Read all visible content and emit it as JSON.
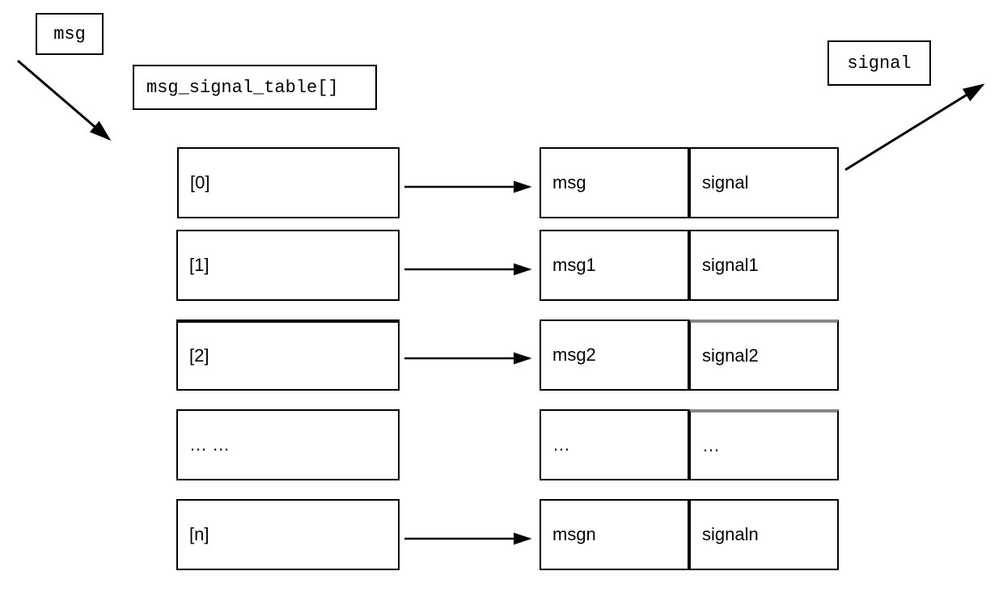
{
  "input_label": "msg",
  "output_label": "signal",
  "table_name": "msg_signal_table[]",
  "index_column": [
    "[0]",
    "[1]",
    "[2]",
    "… …",
    "[n]"
  ],
  "mapping": [
    {
      "msg": "msg",
      "signal": "signal"
    },
    {
      "msg": "msg1",
      "signal": "signal1"
    },
    {
      "msg": "msg2",
      "signal": "signal2"
    },
    {
      "msg": "…",
      "signal": "…"
    },
    {
      "msg": "msgn",
      "signal": "signaln"
    }
  ]
}
